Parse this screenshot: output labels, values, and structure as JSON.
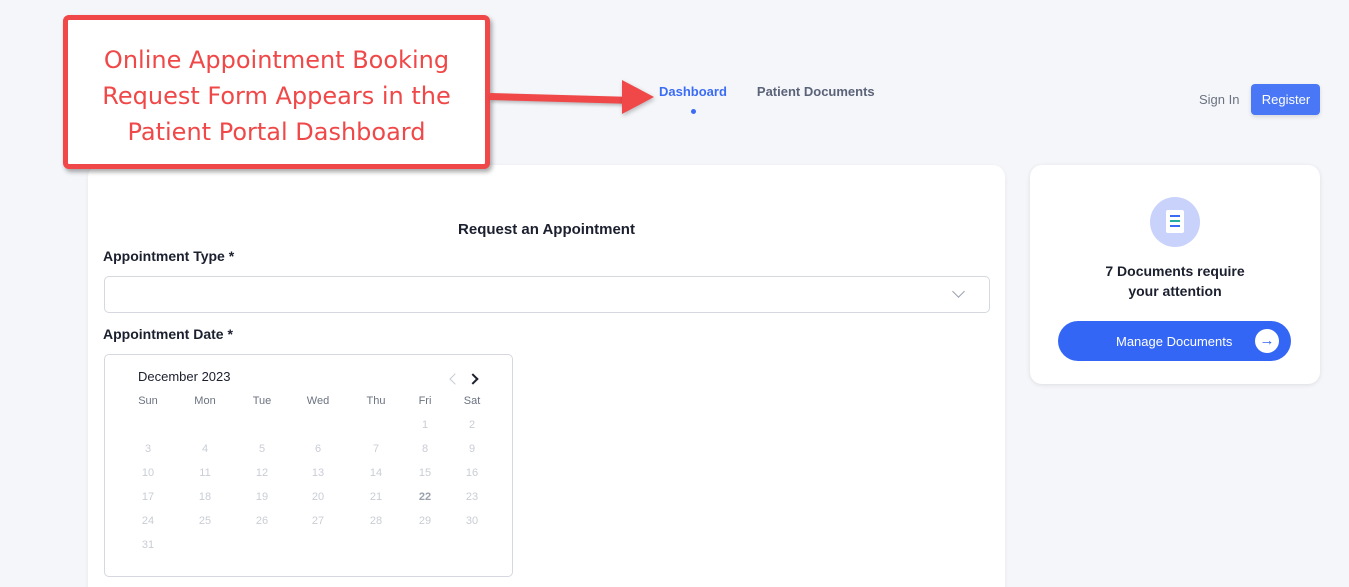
{
  "nav": {
    "items": [
      {
        "label": "Dashboard",
        "active": true
      },
      {
        "label": "Patient Documents",
        "active": false
      }
    ]
  },
  "auth": {
    "signin_label": "Sign In",
    "register_label": "Register"
  },
  "form": {
    "title": "Request an Appointment",
    "appointment_type_label": "Appointment Type *",
    "appointment_type_value": "",
    "appointment_date_label": "Appointment Date *"
  },
  "calendar": {
    "month_label": "December 2023",
    "weekdays": [
      "Sun",
      "Mon",
      "Tue",
      "Wed",
      "Thu",
      "Fri",
      "Sat"
    ],
    "first_weekday_index": 5,
    "days_in_month": 31,
    "today": 22
  },
  "documents": {
    "message_line1": "7 Documents require",
    "message_line2": "your attention",
    "button_label": "Manage Documents",
    "icon": "document-list-icon"
  },
  "callout": {
    "lines": [
      "Online Appointment Booking",
      "Request Form Appears in the",
      "Patient Portal Dashboard"
    ]
  },
  "colors": {
    "accent": "#3b6cf6",
    "callout": "#f04848",
    "page_bg": "#f5f6fa"
  }
}
